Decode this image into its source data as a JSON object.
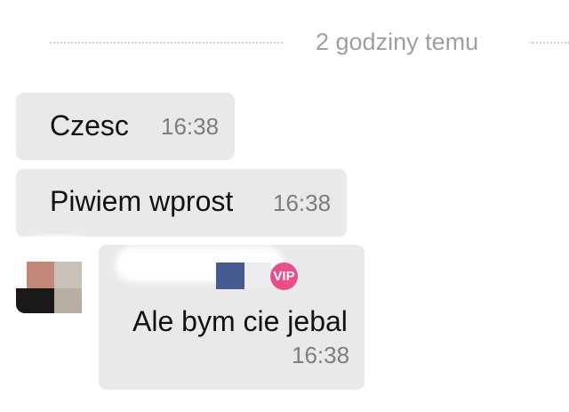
{
  "conversation": {
    "date_divider": "2 godziny temu",
    "messages": [
      {
        "text": "Czesc",
        "time": "16:38"
      },
      {
        "text": "Piwiem wprost",
        "time": "16:38"
      },
      {
        "text": "Ale bym cie jebal",
        "time": "16:38",
        "sender_badge": "VIP"
      }
    ]
  },
  "colors": {
    "bubble_bg": "#e9e9e9",
    "timestamp": "#7d7d7d",
    "divider_text": "#9e9e9e",
    "vip_badge": "#ea4e89"
  },
  "icons": {
    "vip": "vip-badge-icon",
    "flag": "flag-icon"
  }
}
